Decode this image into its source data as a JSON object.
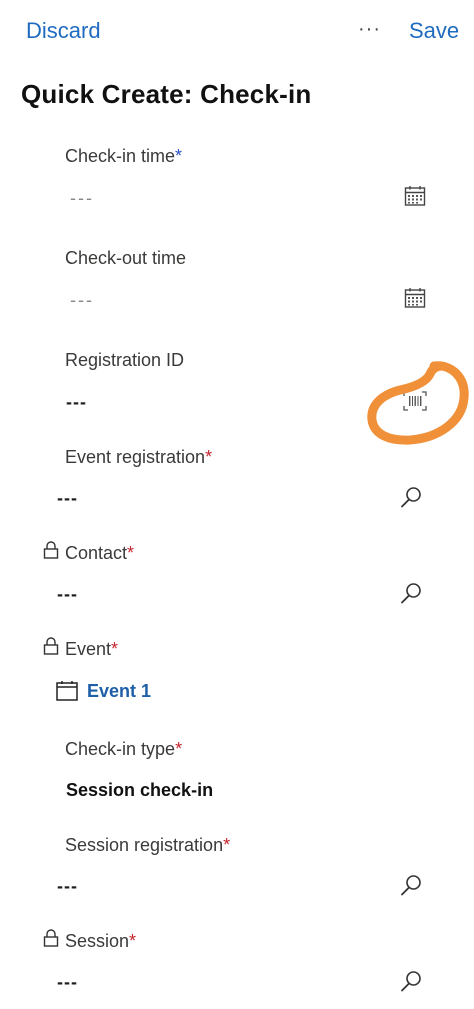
{
  "header": {
    "discard_label": "Discard",
    "more_label": "···",
    "save_label": "Save"
  },
  "page_title": "Quick Create: Check-in",
  "fields": [
    {
      "label": "Check-in time",
      "required_mark": "*",
      "value": "---",
      "icon": "calendar-icon"
    },
    {
      "label": "Check-out time",
      "required_mark": "",
      "value": "---",
      "icon": "calendar-icon"
    },
    {
      "label": "Registration ID",
      "required_mark": "",
      "value": "---",
      "icon": "barcode-scan-icon"
    },
    {
      "label": "Event registration",
      "required_mark": "*",
      "value": "---",
      "icon": "search-icon"
    },
    {
      "label": "Contact",
      "required_mark": "*",
      "value": "---",
      "icon": "search-icon",
      "locked": true
    },
    {
      "label": "Event",
      "required_mark": "*",
      "value": "Event 1",
      "icon": "calendar-icon",
      "locked": true
    },
    {
      "label": "Check-in type",
      "required_mark": "*",
      "value": "Session check-in"
    },
    {
      "label": "Session registration",
      "required_mark": "*",
      "value": "---",
      "icon": "search-icon"
    },
    {
      "label": "Session",
      "required_mark": "*",
      "value": "---",
      "icon": "search-icon",
      "locked": true
    }
  ],
  "colors": {
    "accent": "#1f6bbf",
    "required_blue": "#2b4fc7",
    "required_red": "#c4262e",
    "annotation": "#f0913a"
  }
}
